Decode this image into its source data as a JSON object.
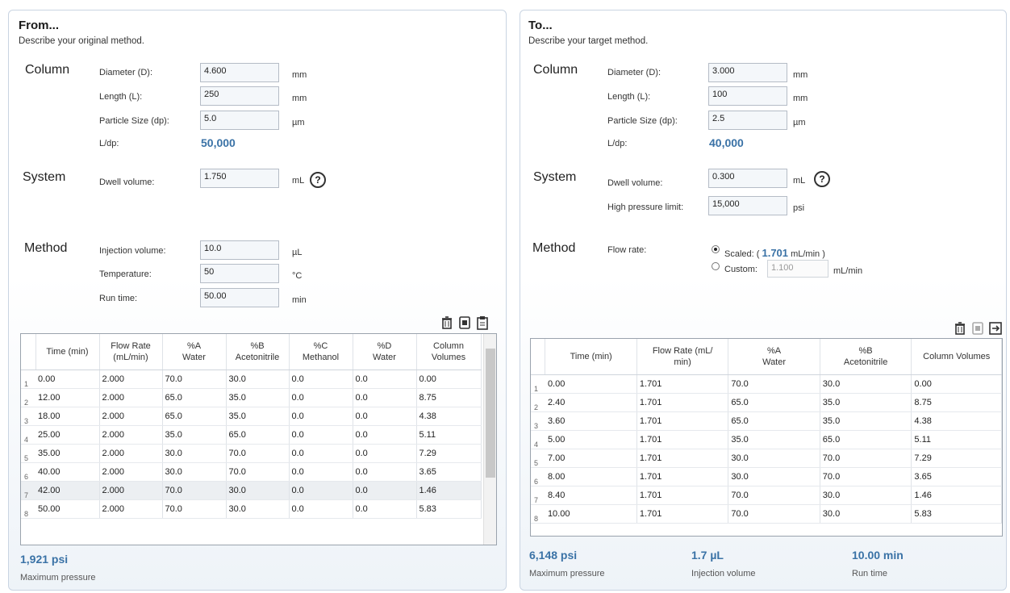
{
  "from": {
    "title": "From...",
    "description": "Describe your original method.",
    "column": {
      "section": "Column",
      "diameter_label": "Diameter (D):",
      "diameter_value": "4.600",
      "diameter_unit": "mm",
      "length_label": "Length (L):",
      "length_value": "250",
      "length_unit": "mm",
      "particle_label": "Particle Size (dp):",
      "particle_value": "5.0",
      "particle_unit": "µm",
      "ldp_label": "L/dp:",
      "ldp_value": "50,000"
    },
    "system": {
      "section": "System",
      "dwell_label": "Dwell volume:",
      "dwell_value": "1.750",
      "dwell_unit": "mL",
      "help_glyph": "?"
    },
    "method": {
      "section": "Method",
      "injection_label": "Injection volume:",
      "injection_value": "10.0",
      "injection_unit": "µL",
      "temp_label": "Temperature:",
      "temp_value": "50",
      "temp_unit": "°C",
      "runtime_label": "Run time:",
      "runtime_value": "50.00",
      "runtime_unit": "min"
    },
    "toolbar_icons": [
      "delete-icon",
      "copy-icon",
      "paste-icon"
    ],
    "table": {
      "headers": [
        {
          "line1": "Time (min)",
          "line2": ""
        },
        {
          "line1": "Flow Rate",
          "line2": "(mL/min)"
        },
        {
          "line1": "%A",
          "line2": "Water"
        },
        {
          "line1": "%B",
          "line2": "Acetonitrile"
        },
        {
          "line1": "%C",
          "line2": "Methanol"
        },
        {
          "line1": "%D",
          "line2": "Water"
        },
        {
          "line1": "Column",
          "line2": "Volumes"
        }
      ],
      "rows": [
        {
          "n": "1",
          "cells": [
            "0.00",
            "2.000",
            "70.0",
            "30.0",
            "0.0",
            "0.0",
            "0.00"
          ]
        },
        {
          "n": "2",
          "cells": [
            "12.00",
            "2.000",
            "65.0",
            "35.0",
            "0.0",
            "0.0",
            "8.75"
          ]
        },
        {
          "n": "3",
          "cells": [
            "18.00",
            "2.000",
            "65.0",
            "35.0",
            "0.0",
            "0.0",
            "4.38"
          ]
        },
        {
          "n": "4",
          "cells": [
            "25.00",
            "2.000",
            "35.0",
            "65.0",
            "0.0",
            "0.0",
            "5.11"
          ]
        },
        {
          "n": "5",
          "cells": [
            "35.00",
            "2.000",
            "30.0",
            "70.0",
            "0.0",
            "0.0",
            "7.29"
          ]
        },
        {
          "n": "6",
          "cells": [
            "40.00",
            "2.000",
            "30.0",
            "70.0",
            "0.0",
            "0.0",
            "3.65"
          ]
        },
        {
          "n": "7",
          "cells": [
            "42.00",
            "2.000",
            "70.0",
            "30.0",
            "0.0",
            "0.0",
            "1.46"
          ]
        },
        {
          "n": "8",
          "cells": [
            "50.00",
            "2.000",
            "70.0",
            "30.0",
            "0.0",
            "0.0",
            "5.83"
          ]
        }
      ],
      "highlighted_row": 7
    },
    "max_pressure_value": "1,921 psi",
    "max_pressure_label": "Maximum pressure"
  },
  "to": {
    "title": "To...",
    "description": "Describe your target method.",
    "column": {
      "section": "Column",
      "diameter_label": "Diameter (D):",
      "diameter_value": "3.000",
      "diameter_unit": "mm",
      "length_label": "Length (L):",
      "length_value": "100",
      "length_unit": "mm",
      "particle_label": "Particle Size (dp):",
      "particle_value": "2.5",
      "particle_unit": "µm",
      "ldp_label": "L/dp:",
      "ldp_value": "40,000"
    },
    "system": {
      "section": "System",
      "dwell_label": "Dwell volume:",
      "dwell_value": "0.300",
      "dwell_unit": "mL",
      "help_glyph": "?",
      "pressure_label": "High pressure limit:",
      "pressure_value": "15,000",
      "pressure_unit": "psi"
    },
    "method": {
      "section": "Method",
      "flow_label": "Flow rate:",
      "scaled_prefix": "Scaled: (",
      "scaled_value": "1.701",
      "scaled_suffix": "mL/min )",
      "custom_label": "Custom:",
      "custom_value": "1.100",
      "custom_unit": "mL/min"
    },
    "toolbar_icons": [
      "delete-icon",
      "copy-icon",
      "export-icon"
    ],
    "table": {
      "headers": [
        {
          "line1": "Time (min)",
          "line2": ""
        },
        {
          "line1": "Flow Rate (mL/",
          "line2": "min)"
        },
        {
          "line1": "%A",
          "line2": "Water"
        },
        {
          "line1": "%B",
          "line2": "Acetonitrile"
        },
        {
          "line1": "Column Volumes",
          "line2": ""
        }
      ],
      "rows": [
        {
          "n": "1",
          "cells": [
            "0.00",
            "1.701",
            "70.0",
            "30.0",
            "0.00"
          ]
        },
        {
          "n": "2",
          "cells": [
            "2.40",
            "1.701",
            "65.0",
            "35.0",
            "8.75"
          ]
        },
        {
          "n": "3",
          "cells": [
            "3.60",
            "1.701",
            "65.0",
            "35.0",
            "4.38"
          ]
        },
        {
          "n": "4",
          "cells": [
            "5.00",
            "1.701",
            "35.0",
            "65.0",
            "5.11"
          ]
        },
        {
          "n": "5",
          "cells": [
            "7.00",
            "1.701",
            "30.0",
            "70.0",
            "7.29"
          ]
        },
        {
          "n": "6",
          "cells": [
            "8.00",
            "1.701",
            "30.0",
            "70.0",
            "3.65"
          ]
        },
        {
          "n": "7",
          "cells": [
            "8.40",
            "1.701",
            "70.0",
            "30.0",
            "1.46"
          ]
        },
        {
          "n": "8",
          "cells": [
            "10.00",
            "1.701",
            "70.0",
            "30.0",
            "5.83"
          ]
        }
      ]
    },
    "max_pressure_value": "6,148 psi",
    "max_pressure_label": "Maximum pressure",
    "injection_stat_value": "1.7 µL",
    "injection_stat_label": "Injection volume",
    "runtime_stat_value": "10.00 min",
    "runtime_stat_label": "Run time"
  }
}
